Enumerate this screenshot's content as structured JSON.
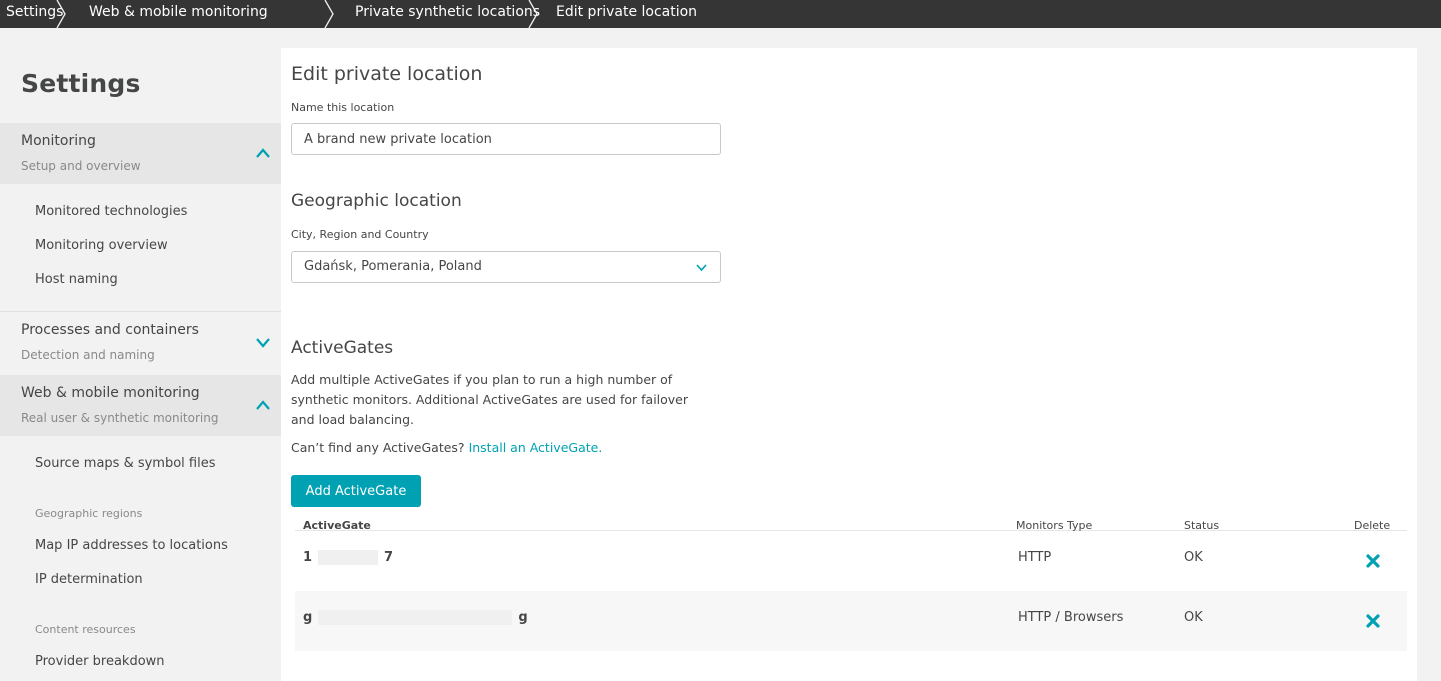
{
  "breadcrumb": {
    "items": [
      "Settings",
      "Web & mobile monitoring",
      "Private synthetic locations",
      "Edit private location"
    ]
  },
  "sidebar": {
    "title": "Settings",
    "sections": [
      {
        "title": "Monitoring",
        "subtitle": "Setup and overview",
        "expanded": true
      },
      {
        "title": "Processes and containers",
        "subtitle": "Detection and naming",
        "expanded": false
      },
      {
        "title": "Web & mobile monitoring",
        "subtitle": "Real user & synthetic monitoring",
        "expanded": true
      }
    ],
    "monitoring_items": [
      "Monitored technologies",
      "Monitoring overview",
      "Host naming"
    ],
    "web_items": {
      "source_maps": "Source maps & symbol files",
      "geo_group": "Geographic regions",
      "map_ip": "Map IP addresses to locations",
      "ip_determination": "IP determination",
      "content_group": "Content resources",
      "provider_breakdown": "Provider breakdown"
    }
  },
  "main": {
    "title": "Edit private location",
    "name_label": "Name this location",
    "name_value": "A brand new private location",
    "geo_heading": "Geographic location",
    "geo_label": "City, Region and Country",
    "geo_value": "Gdańsk, Pomerania, Poland",
    "ag_heading": "ActiveGates",
    "ag_description": "Add multiple ActiveGates if you plan to run a high number of synthetic monitors. Additional ActiveGates are used for failover and load balancing.",
    "ag_help_prefix": "Can’t find any ActiveGates?",
    "ag_help_link": "Install an ActiveGate.",
    "add_button": "Add ActiveGate"
  },
  "table": {
    "headers": {
      "name": "ActiveGate",
      "monitors": "Monitors Type",
      "status": "Status",
      "delete": "Delete"
    },
    "rows": [
      {
        "name_start": "1",
        "name_end": "7",
        "monitors": "HTTP",
        "status": "OK"
      },
      {
        "name_start": "g",
        "name_end": "g",
        "monitors": "HTTP / Browsers",
        "status": "OK"
      }
    ]
  },
  "colors": {
    "accent": "#00a1b2",
    "topbar": "#353535",
    "sidebar_bg": "#f2f2f2",
    "section_active": "#e6e6e6"
  }
}
